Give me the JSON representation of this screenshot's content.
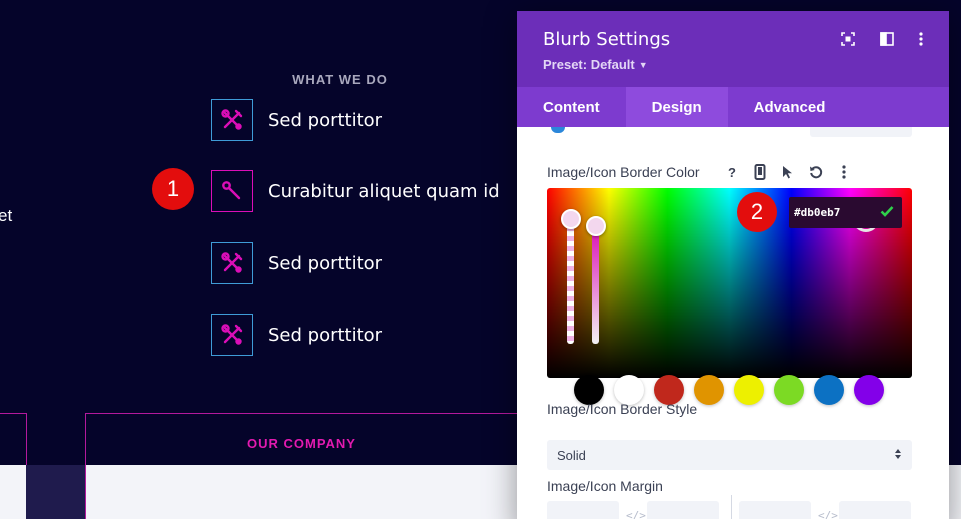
{
  "page": {
    "section_title": "WHAT WE DO",
    "left_fragment": "et",
    "blurbs": [
      {
        "title": "Sed porttitor",
        "icon": "wrench-screwdriver-icon",
        "active": false
      },
      {
        "title": "Curabitur aliquet quam id",
        "icon": "wrench-icon",
        "active": true
      },
      {
        "title": "Sed porttitor",
        "icon": "wrench-screwdriver-icon",
        "active": false
      },
      {
        "title": "Sed porttitor",
        "icon": "wrench-screwdriver-icon",
        "active": false
      }
    ],
    "cta_label": "OUR COMPANY",
    "markers": [
      "1",
      "2"
    ]
  },
  "modal": {
    "title": "Blurb Settings",
    "preset": "Preset: Default",
    "tabs": [
      {
        "label": "Content",
        "active": false
      },
      {
        "label": "Design",
        "active": true
      },
      {
        "label": "Advanced",
        "active": false
      }
    ],
    "border_color": {
      "label": "Image/Icon Border Color",
      "hex": "#db0eb7",
      "icons": [
        "help-icon",
        "mobile-icon",
        "pointer-icon",
        "reset-icon",
        "more-icon"
      ]
    },
    "swatches": [
      "#000000",
      "#ffffff",
      "#c0281c",
      "#e09400",
      "#edf000",
      "#7cda24",
      "#0c71c3",
      "#8300e9"
    ],
    "border_style": {
      "label": "Image/Icon Border Style",
      "value": "Solid"
    },
    "margin": {
      "label": "Image/Icon Margin"
    }
  },
  "colors": {
    "page_bg": "#05042a",
    "accent": "#db0eb7",
    "modal_header": "#6c2eb9",
    "tabs_bg": "#7d3bcf",
    "icon_border": "#3f9bd6"
  }
}
